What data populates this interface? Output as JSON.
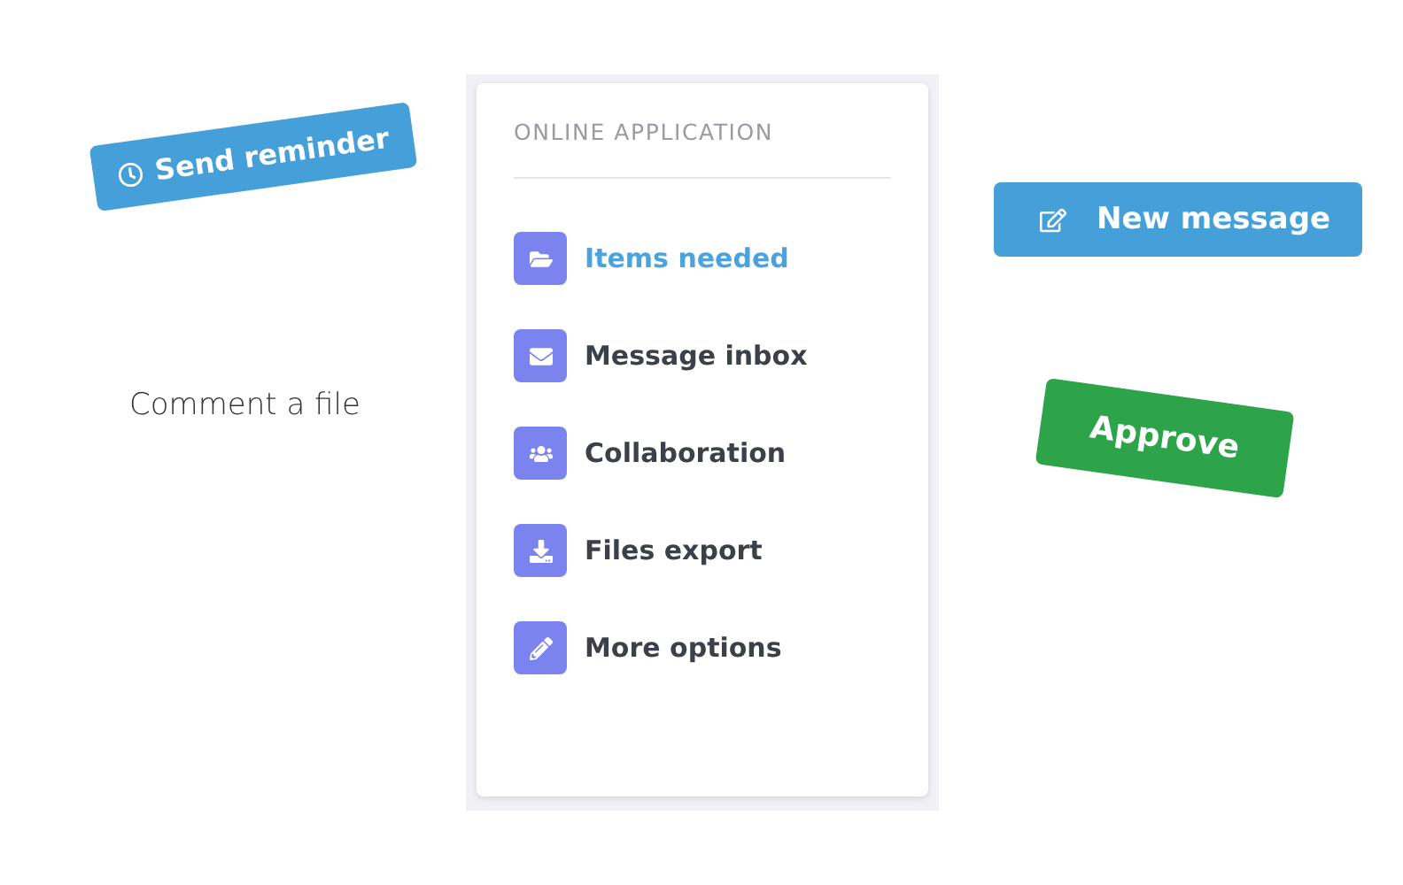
{
  "left": {
    "reminder_button": {
      "label": "Send reminder"
    },
    "comment_text": "Comment a file"
  },
  "menu_card": {
    "title": "ONLINE APPLICATION",
    "items": [
      {
        "label": "Items needed",
        "selected": true
      },
      {
        "label": "Message inbox",
        "selected": false
      },
      {
        "label": "Collaboration",
        "selected": false
      },
      {
        "label": "Files export",
        "selected": false
      },
      {
        "label": "More options",
        "selected": false
      }
    ]
  },
  "right": {
    "new_message_button": {
      "label": "New message"
    },
    "approve_button": {
      "label": "Approve"
    }
  }
}
